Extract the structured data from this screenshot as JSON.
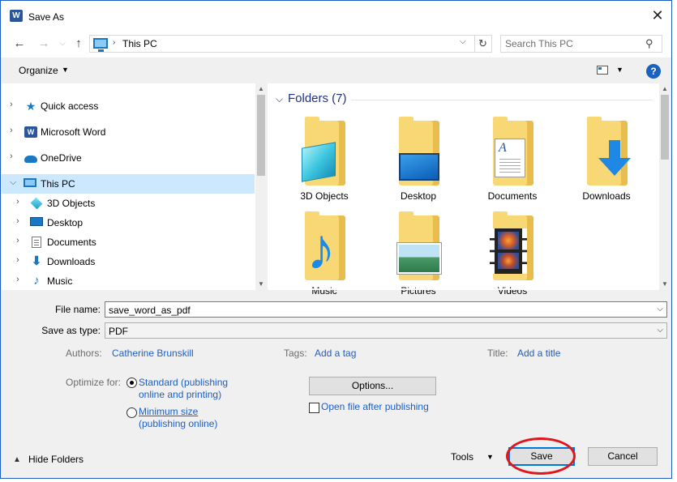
{
  "window": {
    "title": "Save As",
    "close_glyph": "✕"
  },
  "address_bar": {
    "location": "This PC",
    "separator": "›",
    "dropdown_glyph": "⌵",
    "refresh_glyph": "↻"
  },
  "navigation": {
    "back": "←",
    "forward": "→",
    "up": "↑"
  },
  "search": {
    "placeholder": "Search This PC",
    "icon_glyph": "⚲"
  },
  "toolbar": {
    "organize_label": "Organize",
    "caret": "▼",
    "help_glyph": "?"
  },
  "nav_pane": {
    "items": [
      {
        "label": "Quick access",
        "icon": "star-icon",
        "chevron": "›"
      },
      {
        "label": "Microsoft Word",
        "icon": "word-icon",
        "chevron": "›"
      },
      {
        "label": "OneDrive",
        "icon": "cloud-icon",
        "chevron": "›"
      },
      {
        "label": "This PC",
        "icon": "computer-icon",
        "chevron": "⌵",
        "selected": true
      },
      {
        "label": "3D Objects",
        "icon": "cube-icon",
        "chevron": "›"
      },
      {
        "label": "Desktop",
        "icon": "desktop-icon",
        "chevron": "›"
      },
      {
        "label": "Documents",
        "icon": "document-icon",
        "chevron": "›"
      },
      {
        "label": "Downloads",
        "icon": "download-icon",
        "chevron": "›"
      },
      {
        "label": "Music",
        "icon": "music-icon",
        "chevron": "›"
      }
    ]
  },
  "content": {
    "group_title": "Folders (7)",
    "group_caret": "⌵",
    "folders": [
      {
        "label": "3D Objects",
        "icon": "3d-objects-folder-icon"
      },
      {
        "label": "Desktop",
        "icon": "desktop-folder-icon"
      },
      {
        "label": "Documents",
        "icon": "documents-folder-icon"
      },
      {
        "label": "Downloads",
        "icon": "downloads-folder-icon"
      },
      {
        "label": "Music",
        "icon": "music-folder-icon"
      },
      {
        "label": "Pictures",
        "icon": "pictures-folder-icon"
      },
      {
        "label": "Videos",
        "icon": "videos-folder-icon"
      }
    ]
  },
  "scroll": {
    "up": "▲",
    "down": "▼"
  },
  "form": {
    "file_name_label": "File name:",
    "file_name_value": "save_word_as_pdf",
    "save_type_label": "Save as type:",
    "save_type_value": "PDF",
    "dropdown_glyph": "⌵"
  },
  "metadata": {
    "authors_label": "Authors:",
    "authors_value": "Catherine Brunskill",
    "tags_label": "Tags:",
    "tags_value": "Add a tag",
    "title_label": "Title:",
    "title_value": "Add a title"
  },
  "optimize": {
    "label": "Optimize for:",
    "standard_line1": "Standard (publishing",
    "standard_line2": "online and printing)",
    "minimum_line1": "Minimum size",
    "minimum_line2": "(publishing online)",
    "selected": "standard"
  },
  "options": {
    "button_label": "Options...",
    "open_after_label": "Open file after publishing",
    "open_after_checked": false
  },
  "footer": {
    "hide_folders_label": "Hide Folders",
    "hide_caret": "▲",
    "tools_label": "Tools",
    "tools_caret": "▼",
    "save_label": "Save",
    "cancel_label": "Cancel"
  },
  "colors": {
    "accent": "#0078d7",
    "link": "#1e5ec4",
    "selection": "#cce8ff",
    "annotation_circle": "#e0161c"
  }
}
